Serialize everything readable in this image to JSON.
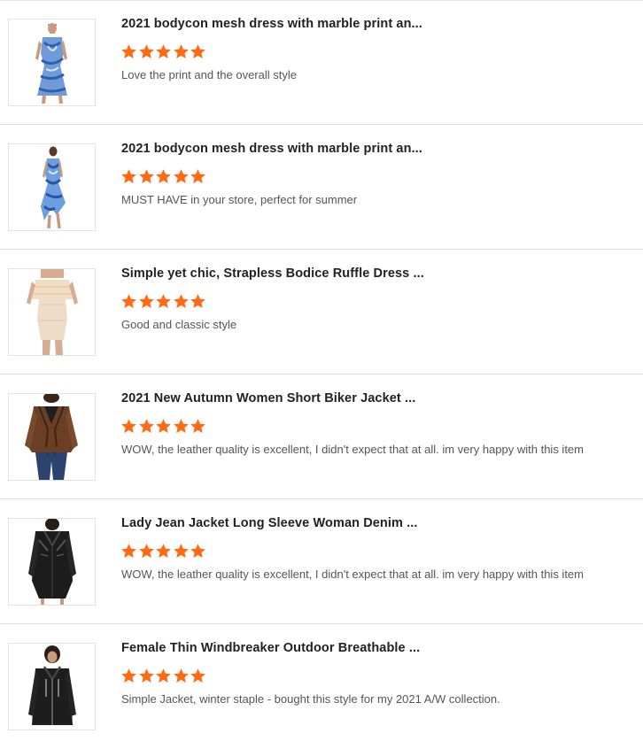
{
  "colors": {
    "star": "#ff6a13",
    "title": "#222222",
    "comment": "#555555",
    "divider": "#dcdcdc"
  },
  "reviews": [
    {
      "thumbnail_icon": "blue-tie-dye-bodycon-dress-photo",
      "title": "2021 bodycon mesh dress with marble print an...",
      "rating": 5,
      "comment": "Love the print and the overall style"
    },
    {
      "thumbnail_icon": "blue-marble-asymmetric-dress-photo",
      "title": "2021 bodycon mesh dress with marble print an...",
      "rating": 5,
      "comment": "MUST HAVE in your store, perfect for summer"
    },
    {
      "thumbnail_icon": "cream-strapless-ruffle-dress-photo",
      "title": "Simple yet chic, Strapless Bodice Ruffle Dress ...",
      "rating": 5,
      "comment": "Good and classic style"
    },
    {
      "thumbnail_icon": "brown-leather-biker-jacket-photo",
      "title": "2021 New Autumn Women Short Biker Jacket ...",
      "rating": 5,
      "comment": "WOW, the leather quality is excellent, I didn't expect that at all. im very happy with this item"
    },
    {
      "thumbnail_icon": "black-long-leather-jacket-photo",
      "title": "Lady Jean Jacket Long Sleeve Woman Denim ...",
      "rating": 5,
      "comment": "WOW, the leather quality is excellent, I didn't expect that at all. im very happy with this item"
    },
    {
      "thumbnail_icon": "black-windbreaker-jacket-photo",
      "title": "Female Thin Windbreaker Outdoor Breathable ...",
      "rating": 5,
      "comment": "Simple Jacket, winter staple - bought this style for my 2021 A/W collection."
    }
  ]
}
